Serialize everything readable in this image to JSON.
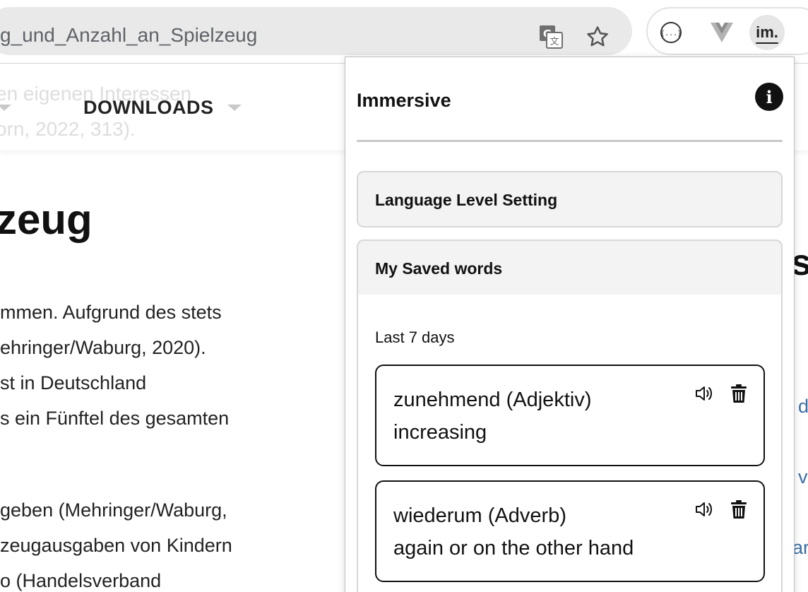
{
  "browser": {
    "url": "g_und_Anzahl_an_Spielzeug",
    "icons": [
      "google-translate-icon",
      "bookmark-star-icon",
      "json-formatter-icon",
      "vue-devtools-icon",
      "immersive-extension-icon"
    ],
    "extension_label": "im."
  },
  "site": {
    "nav_item": "DOWNLOADS",
    "ghost_line_1": "en eigenen Interessen",
    "ghost_line_2": "orn, 2022, 313)."
  },
  "article": {
    "heading": "zeug",
    "paragraph_1": [
      "mmen. Aufgrund des stets",
      "ehringer/Waburg, 2020).",
      "st in Deutschland",
      "s ein Fünftel des gesamten"
    ],
    "paragraph_2": [
      "geben (Mehringer/Waburg,",
      "zeugausgaben von Kindern",
      "o (Handelsverband"
    ],
    "right_edge": {
      "top_glyph": "s",
      "link_1": "d",
      "link_2": "v",
      "link_3": "ar"
    }
  },
  "popup": {
    "title": "Immersive",
    "info_icon": "info-icon",
    "language_level_label": "Language Level Setting",
    "saved_words_label": "My Saved words",
    "period_label": "Last 7 days",
    "words": [
      {
        "term": "zunehmend (Adjektiv)",
        "translation": "increasing"
      },
      {
        "term": "wiederum (Adverb)",
        "translation": "again or on the other hand"
      }
    ]
  },
  "colors": {
    "omnibox": "#e9e9e9",
    "panel_header": "#f3f3f3",
    "text": "#111111",
    "link": "#3b6ea5"
  }
}
